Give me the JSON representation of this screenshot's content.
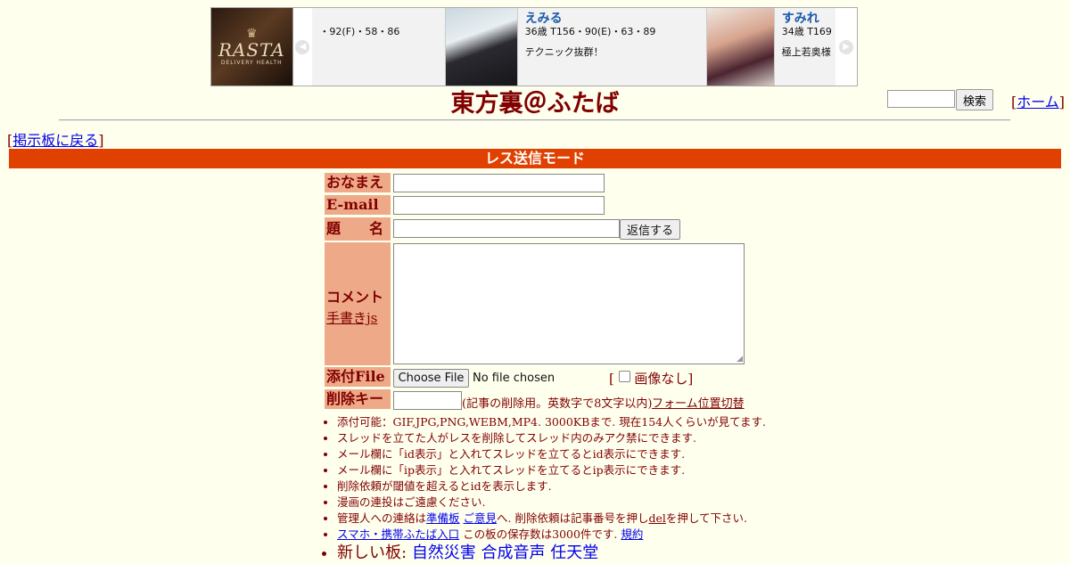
{
  "banner": {
    "logo": {
      "name": "RASTA",
      "sub": "DELIVERY HEALTH"
    },
    "slide0": {
      "stats": "・92(F)・58・86"
    },
    "slide1": {
      "name": "えみる",
      "stats": "36歳 T156・90(E)・63・89",
      "desc": "テクニック抜群！"
    },
    "slide2": {
      "name": "すみれ",
      "stats": "34歳 T169",
      "desc": "極上若奥様"
    }
  },
  "header": {
    "title": "東方裏＠ふたば",
    "search_button": "検索",
    "home_link": "ホーム",
    "back_link": "掲示板に戻る",
    "mode": "レス送信モード"
  },
  "form": {
    "name_label": "おなまえ",
    "email_label": "E-mail",
    "subject_label": "題　　名",
    "submit_button": "返信する",
    "comment_label": "コメント",
    "handwrite_link": "手書きjs",
    "file_label": "添付File",
    "choose_file_button": "Choose File",
    "no_file_text": "No file chosen",
    "no_image_label": "画像なし",
    "delkey_label": "削除キー",
    "delkey_note": "(記事の削除用。英数字で8文字以内)",
    "form_switch_link": "フォーム位置切替"
  },
  "notes": {
    "n1": "添付可能：GIF,JPG,PNG,WEBM,MP4. 3000KBまで. 現在154人くらいが見てます.",
    "n2": "スレッドを立てた人がレスを削除してスレッド内のみアク禁にできます.",
    "n3": "メール欄に「id表示」と入れてスレッドを立てるとid表示にできます.",
    "n4": "メール欄に「ip表示」と入れてスレッドを立てるとip表示にできます.",
    "n5": "削除依頼が閾値を超えるとidを表示します.",
    "n6": "漫画の連投はご遠慮ください.",
    "n7_pre": "管理人への連絡は",
    "n7_link1": "準備板",
    "n7_link2": "ご意見",
    "n7_mid": "へ. 削除依頼は記事番号を押し",
    "n7_del": "del",
    "n7_post": "を押して下さい.",
    "n8_link": "スマホ・携帯ふたば入口",
    "n8_mid": "この板の保存数は3000件です.",
    "n8_rules": "規約",
    "n9_pre": "新しい板:",
    "n9_board1": "自然災害",
    "n9_board2": "合成音声",
    "n9_board3": "任天堂"
  }
}
